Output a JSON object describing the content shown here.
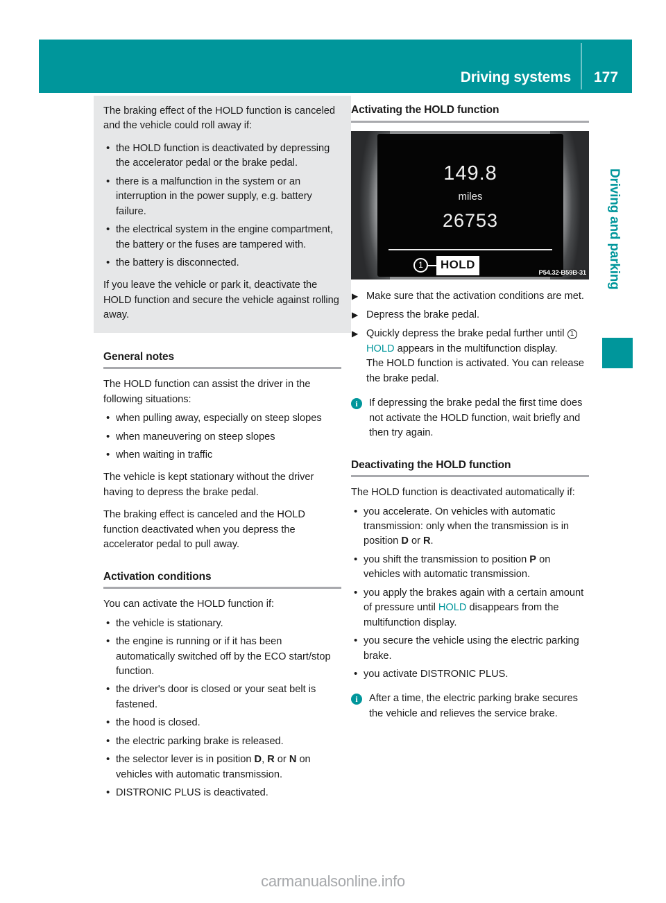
{
  "header": {
    "title": "Driving systems",
    "page_number": "177",
    "accent_color": "#00969B"
  },
  "side_tab": {
    "label": "Driving and parking"
  },
  "left_column": {
    "warning_box": {
      "intro": "The braking effect of the HOLD function is canceled and the vehicle could roll away if:",
      "bullets": [
        "the HOLD function is deactivated by depressing the accelerator pedal or the brake pedal.",
        "there is a malfunction in the system or an interruption in the power supply, e.g. battery failure.",
        "the electrical system in the engine compartment, the battery or the fuses are tampered with.",
        "the battery is disconnected."
      ],
      "outro": "If you leave the vehicle or park it, deactivate the HOLD function and secure the vehicle against rolling away."
    },
    "general_notes": {
      "heading": "General notes",
      "intro": "The HOLD function can assist the driver in the following situations:",
      "bullets": [
        "when pulling away, especially on steep slopes",
        "when maneuvering on steep slopes",
        "when waiting in traffic"
      ],
      "para1": "The vehicle is kept stationary without the driver having to depress the brake pedal.",
      "para2": "The braking effect is canceled and the HOLD function deactivated when you depress the accelerator pedal to pull away."
    },
    "activation_conditions": {
      "heading": "Activation conditions",
      "intro": "You can activate the HOLD function if:",
      "bullets": [
        {
          "text": "the vehicle is stationary."
        },
        {
          "text": "the engine is running or if it has been automatically switched off by the ECO start/stop function."
        },
        {
          "text": "the driver's door is closed or your seat belt is fastened."
        },
        {
          "text": "the hood is closed."
        },
        {
          "text": "the electric parking brake is released."
        },
        {
          "pre": "the selector lever is in position ",
          "b1": "D",
          "mid1": ", ",
          "b2": "R",
          "mid2": " or ",
          "b3": "N",
          "post": " on vehicles with automatic transmission."
        },
        {
          "text": "DISTRONIC PLUS is deactivated."
        }
      ]
    }
  },
  "right_column": {
    "activating": {
      "heading": "Activating the HOLD function",
      "figure": {
        "trip_value": "149.8",
        "unit": "miles",
        "odometer": "26753",
        "callout_number": "1",
        "hold_label": "HOLD",
        "image_code": "P54.32-B59B-31"
      },
      "steps": [
        {
          "text": "Make sure that the activation conditions are met."
        },
        {
          "text": "Depress the brake pedal."
        },
        {
          "pre": "Quickly depress the brake pedal further until ",
          "circled": "1",
          "teal": "HOLD",
          "post": " appears in the multifunction display.",
          "extra": "The HOLD function is activated. You can release the brake pedal."
        }
      ],
      "note": "If depressing the brake pedal the first time does not activate the HOLD function, wait briefly and then try again."
    },
    "deactivating": {
      "heading": "Deactivating the HOLD function",
      "intro": "The HOLD function is deactivated automatically if:",
      "bullets": [
        {
          "pre": "you accelerate. On vehicles with automatic transmission: only when the transmission is in position ",
          "b1": "D",
          "mid1": " or ",
          "b2": "R",
          "post": "."
        },
        {
          "pre": "you shift the transmission to position ",
          "b1": "P",
          "post": " on vehicles with automatic transmission."
        },
        {
          "pre": "you apply the brakes again with a certain amount of pressure until ",
          "teal": "HOLD",
          "post": " disappears from the multifunction display."
        },
        {
          "text": "you secure the vehicle using the electric parking brake."
        },
        {
          "text": "you activate DISTRONIC PLUS."
        }
      ],
      "note": "After a time, the electric parking brake secures the vehicle and relieves the service brake."
    }
  },
  "footer": {
    "watermark": "carmanualsonline.info"
  }
}
